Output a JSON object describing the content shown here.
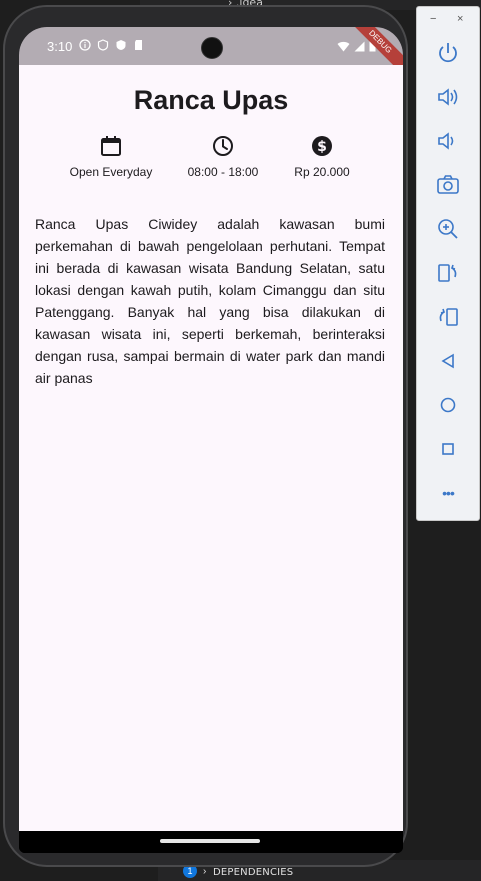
{
  "ide": {
    "top_text": "› .idea",
    "bottom_badge": "1",
    "bottom_label": "DEPENDENCIES"
  },
  "status_bar": {
    "time": "3:10",
    "debug_banner": "DEBUG"
  },
  "app": {
    "title": "Ranca Upas",
    "info": {
      "days": "Open Everyday",
      "hours": "08:00 - 18:00",
      "price": "Rp 20.000"
    },
    "description": "Ranca Upas Ciwidey adalah kawasan bumi perkemahan di bawah pengelolaan perhutani. Tempat ini berada di kawasan wisata Bandung Selatan, satu lokasi dengan kawah putih, kolam Cimanggu dan situ Patenggang. Banyak hal yang bisa dilakukan di kawasan wisata ini, seperti berkemah, berinteraksi dengan rusa, sampai bermain di water park dan mandi air panas"
  },
  "emulator_panel": {
    "minimize": "−",
    "close": "×",
    "tools": [
      "power-icon",
      "volume-up-icon",
      "volume-down-icon",
      "camera-icon",
      "zoom-icon",
      "rotate-left-icon",
      "rotate-right-icon",
      "back-icon",
      "home-icon",
      "overview-icon",
      "more-icon"
    ],
    "more_label": "•••"
  },
  "colors": {
    "app_background": "#fdf7fd",
    "status_bar": "#b3acb3",
    "text": "#1d1b1e",
    "debug_ribbon": "#b5403a",
    "panel_icon": "#3c78c8"
  }
}
